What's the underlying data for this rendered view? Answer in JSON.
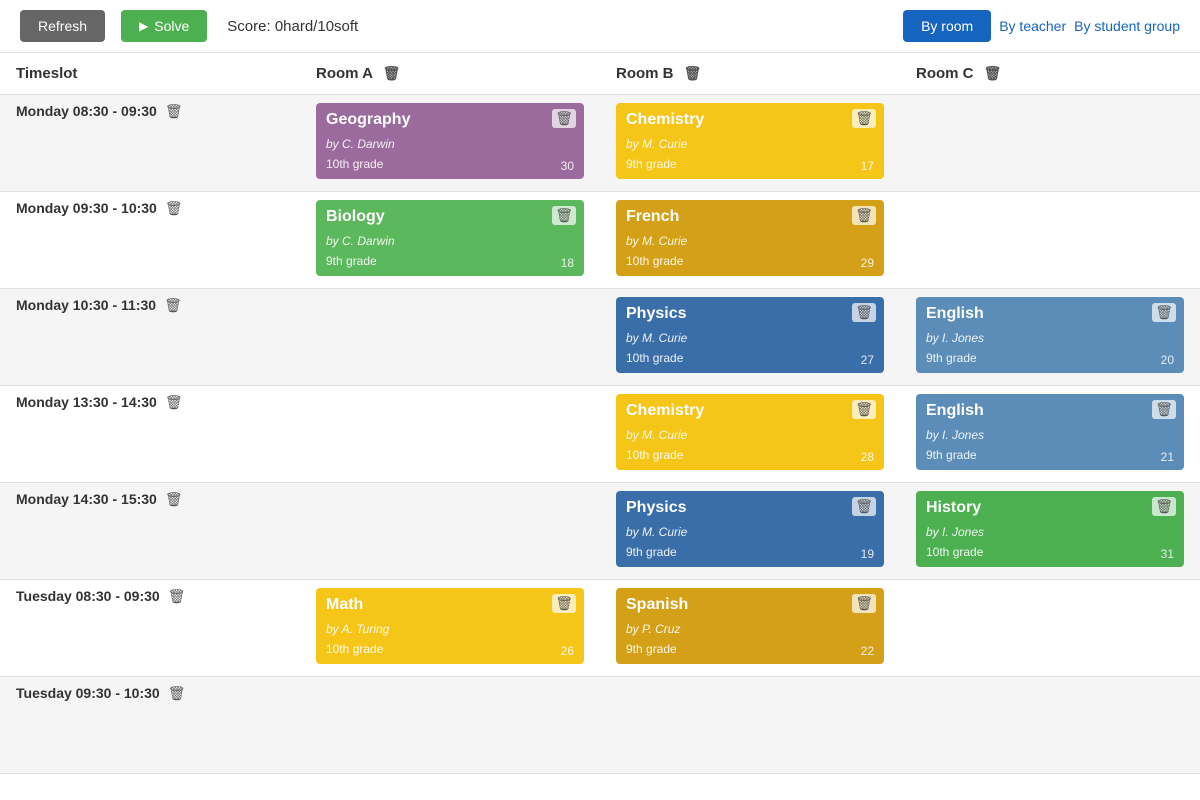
{
  "header": {
    "refresh_label": "Refresh",
    "solve_label": "Solve",
    "score_label": "Score: 0hard/10soft",
    "view_by_room_label": "By room",
    "view_by_teacher_label": "By teacher",
    "view_by_group_label": "By student group"
  },
  "table": {
    "timeslot_header": "Timeslot",
    "rooms": [
      {
        "name": "Room A"
      },
      {
        "name": "Room B"
      },
      {
        "name": "Room C"
      }
    ],
    "rows": [
      {
        "timeslot": "Monday 08:30 - 09:30",
        "shaded": true,
        "cells": [
          {
            "subject": "Geography",
            "teacher": "by C. Darwin",
            "grade": "10th grade",
            "count": "30",
            "color": "card-purple"
          },
          {
            "subject": "Chemistry",
            "teacher": "by M. Curie",
            "grade": "9th grade",
            "count": "17",
            "color": "card-yellow"
          },
          null
        ]
      },
      {
        "timeslot": "Monday 09:30 - 10:30",
        "shaded": false,
        "cells": [
          {
            "subject": "Biology",
            "teacher": "by C. Darwin",
            "grade": "9th grade",
            "count": "18",
            "color": "card-green"
          },
          {
            "subject": "French",
            "teacher": "by M. Curie",
            "grade": "10th grade",
            "count": "29",
            "color": "card-gold"
          },
          null
        ]
      },
      {
        "timeslot": "Monday 10:30 - 11:30",
        "shaded": true,
        "cells": [
          null,
          {
            "subject": "Physics",
            "teacher": "by M. Curie",
            "grade": "10th grade",
            "count": "27",
            "color": "card-blue-dark"
          },
          {
            "subject": "English",
            "teacher": "by I. Jones",
            "grade": "9th grade",
            "count": "20",
            "color": "card-blue-light"
          }
        ]
      },
      {
        "timeslot": "Monday 13:30 - 14:30",
        "shaded": false,
        "cells": [
          null,
          {
            "subject": "Chemistry",
            "teacher": "by M. Curie",
            "grade": "10th grade",
            "count": "28",
            "color": "card-yellow"
          },
          {
            "subject": "English",
            "teacher": "by I. Jones",
            "grade": "9th grade",
            "count": "21",
            "color": "card-blue-light"
          }
        ]
      },
      {
        "timeslot": "Monday 14:30 - 15:30",
        "shaded": true,
        "cells": [
          null,
          {
            "subject": "Physics",
            "teacher": "by M. Curie",
            "grade": "9th grade",
            "count": "19",
            "color": "card-blue-dark"
          },
          {
            "subject": "History",
            "teacher": "by I. Jones",
            "grade": "10th grade",
            "count": "31",
            "color": "card-green-bright"
          }
        ]
      },
      {
        "timeslot": "Tuesday 08:30 - 09:30",
        "shaded": false,
        "cells": [
          {
            "subject": "Math",
            "teacher": "by A. Turing",
            "grade": "10th grade",
            "count": "26",
            "color": "card-yellow"
          },
          {
            "subject": "Spanish",
            "teacher": "by P. Cruz",
            "grade": "9th grade",
            "count": "22",
            "color": "card-gold"
          },
          null
        ]
      },
      {
        "timeslot": "Tuesday 09:30 - 10:30",
        "shaded": true,
        "cells": [
          {
            "subject": "",
            "teacher": "",
            "grade": "",
            "count": "",
            "color": "card-yellow",
            "partial": true
          },
          {
            "subject": "",
            "teacher": "",
            "grade": "",
            "count": "",
            "color": "card-gold",
            "partial": true
          },
          null
        ]
      }
    ]
  }
}
